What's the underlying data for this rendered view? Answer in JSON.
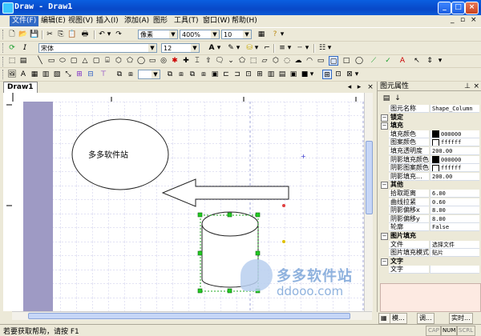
{
  "window": {
    "title": "Draw - Draw1"
  },
  "menu": {
    "items": [
      "文件(F)",
      "编辑(E)",
      "视图(V)",
      "插入(I)",
      "添加(A)",
      "图形",
      "工具(T)",
      "窗口(W)",
      "帮助(H)"
    ],
    "right_controls": [
      "_",
      "▫",
      "×"
    ]
  },
  "toolbar": {
    "unit": "像素",
    "zoom": "400%",
    "line_size": "10",
    "font": "宋体",
    "font_size": "12"
  },
  "document": {
    "tab": "Draw1"
  },
  "canvas": {
    "ellipse_text": "多多软件站",
    "watermark_main": "多多软件站",
    "watermark_sub": "ddooo.com"
  },
  "props": {
    "title": "图元属性",
    "rows": [
      {
        "type": "row",
        "k": "图元名称",
        "v": "Shape_Column"
      },
      {
        "type": "cat",
        "k": "锁定"
      },
      {
        "type": "cat",
        "k": "填充"
      },
      {
        "type": "row",
        "k": "填充颜色",
        "v": "000000",
        "swatch": "#000000"
      },
      {
        "type": "row",
        "k": "图案颜色",
        "v": "ffffff",
        "swatch": "#ffffff"
      },
      {
        "type": "row",
        "k": "填充透明度",
        "v": "200.00"
      },
      {
        "type": "row",
        "k": "阴影填充颜色",
        "v": "000000",
        "swatch": "#000000"
      },
      {
        "type": "row",
        "k": "阴影图案颜色",
        "v": "ffffff",
        "swatch": "#ffffff"
      },
      {
        "type": "row",
        "k": "阴影填充...",
        "v": "200.00"
      },
      {
        "type": "cat",
        "k": "其他"
      },
      {
        "type": "row",
        "k": "拾取距离",
        "v": "6.00"
      },
      {
        "type": "row",
        "k": "曲线拉紧",
        "v": "0.60"
      },
      {
        "type": "row",
        "k": "阴影偏移x",
        "v": "8.00"
      },
      {
        "type": "row",
        "k": "阴影偏移y",
        "v": "8.00"
      },
      {
        "type": "row",
        "k": "轮廓",
        "v": "False"
      },
      {
        "type": "cat",
        "k": "图片填充"
      },
      {
        "type": "row",
        "k": "文件",
        "v": "选择文件"
      },
      {
        "type": "row",
        "k": "图片填充模式",
        "v": "贴片"
      },
      {
        "type": "cat",
        "k": "文字"
      },
      {
        "type": "row",
        "k": "文字",
        "v": ""
      }
    ],
    "tabs": [
      "模...",
      "调...",
      "实时..."
    ]
  },
  "status": {
    "message": "若要获取帮助，请按 F1",
    "indicators": [
      "CAP",
      "NUM",
      "SCRL"
    ]
  },
  "colors": {
    "titlebar": "#0a5fe0",
    "margin_band": "#9e9ac4",
    "selection": "#22aa22",
    "watermark": "#8fb2de"
  }
}
